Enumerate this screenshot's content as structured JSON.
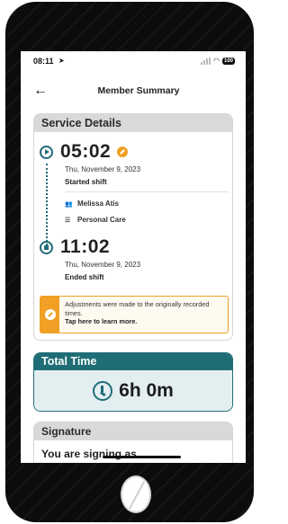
{
  "status_bar": {
    "time": "08:11",
    "battery": "100"
  },
  "header": {
    "back_icon": "arrow-left-icon",
    "title": "Member Summary"
  },
  "service_details": {
    "heading": "Service Details",
    "start": {
      "time": "05:02",
      "date": "Thu, November 9, 2023",
      "label": "Started shift"
    },
    "member_name": "Melissa Atis",
    "service_type": "Personal Care",
    "end": {
      "time": "11:02",
      "date": "Thu, November 9, 2023",
      "label": "Ended shift"
    },
    "notice": {
      "text": "Adjustments were made to the originally recorded times.",
      "link": "Tap here to learn more."
    }
  },
  "total_time": {
    "heading": "Total Time",
    "value": "6h 0m"
  },
  "signature": {
    "heading": "Signature",
    "text": "You are signing as..."
  },
  "colors": {
    "accent": "#1f6d77",
    "warning": "#f0a025",
    "section_header": "#d9d9d9"
  }
}
